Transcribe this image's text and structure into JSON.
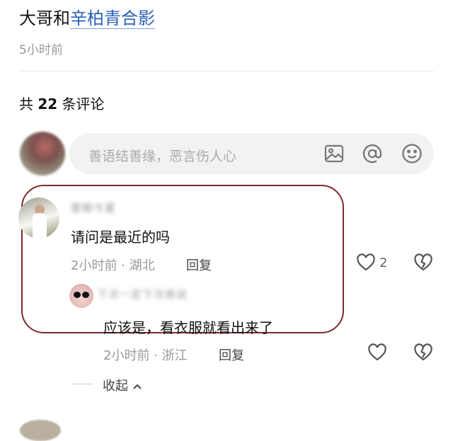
{
  "post": {
    "title_prefix": "大哥和",
    "title_link": "辛柏青合影",
    "time": "5小时前"
  },
  "comments_header": {
    "prefix": "共 ",
    "count": "22",
    "suffix": " 条评论"
  },
  "input": {
    "placeholder": "善语结善缘，恶言伤人心"
  },
  "comments": [
    {
      "username": "蒙眼今夏",
      "text": "请问是最近的吗",
      "meta": "2小时前 · 湖北",
      "reply_label": "回复",
      "likes": "2",
      "replies": [
        {
          "username": "下次一定下次再说",
          "text": "应该是，看衣服就看出来了",
          "meta": "2小时前 · 浙江",
          "reply_label": "回复"
        }
      ]
    }
  ],
  "collapse_label": "收起",
  "icons": {
    "image": "image-icon",
    "at": "at-icon",
    "emoji": "emoji-icon",
    "like": "heart-icon",
    "dislike": "broken-heart-icon",
    "collapse": "chevron-up-icon"
  },
  "colors": {
    "link": "#2b61b8",
    "highlight_border": "#7e2a2a",
    "muted": "#999999"
  }
}
